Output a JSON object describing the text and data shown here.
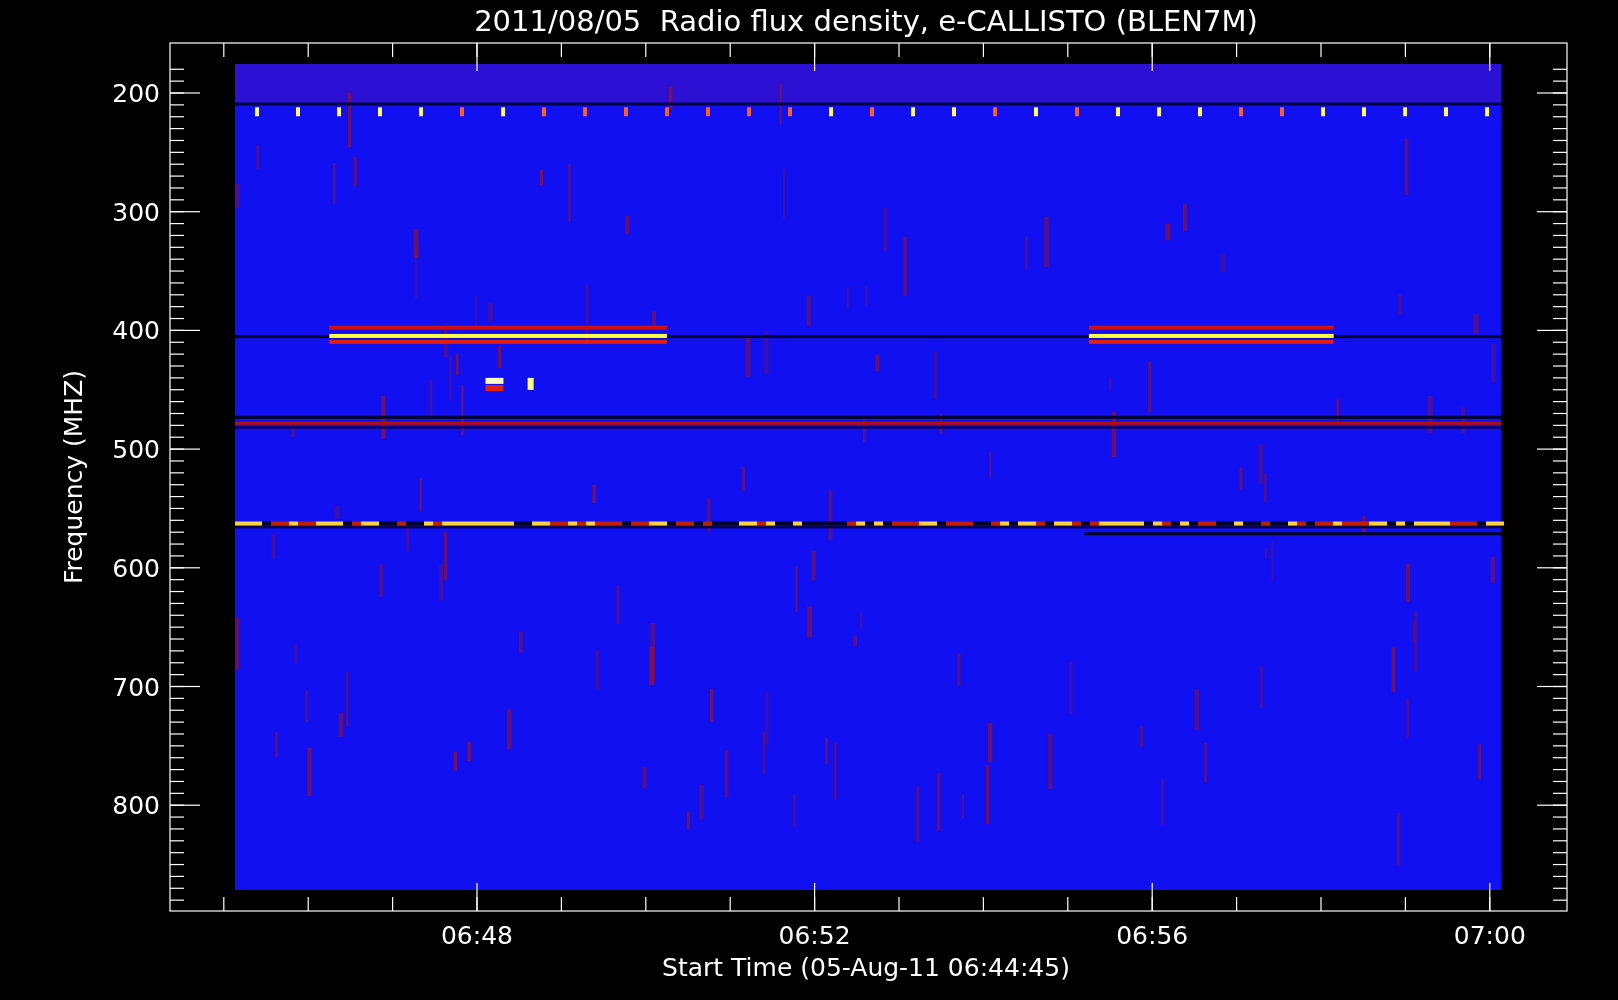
{
  "title": "2011/08/05  Radio flux density, e-CALLISTO (BLEN7M)",
  "y_axis": {
    "label": "Frequency (MHZ)",
    "tick_labels": [
      "200",
      "300",
      "400",
      "500",
      "600",
      "700",
      "800"
    ]
  },
  "x_axis": {
    "label": "Start Time (05-Aug-11 06:44:45)",
    "tick_labels": [
      "06:48",
      "06:52",
      "06:56",
      "07:00"
    ]
  }
}
